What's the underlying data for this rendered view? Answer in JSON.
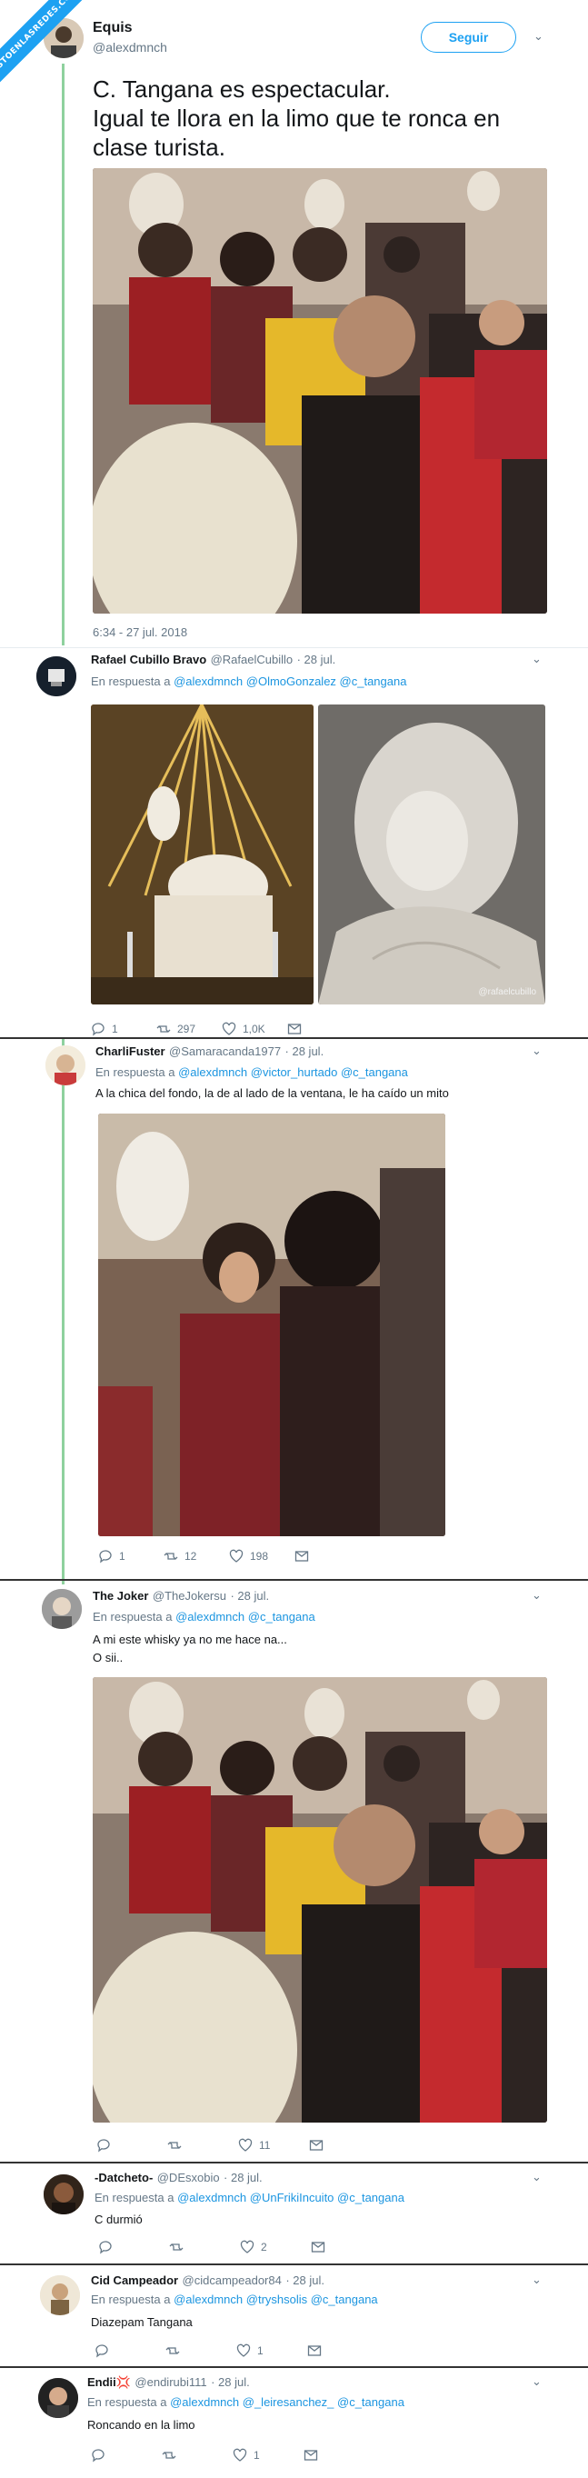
{
  "watermark": "VISTOENLASREDES.COM",
  "main_tweet": {
    "name": "Equis",
    "handle": "@alexdmnch",
    "follow_label": "Seguir",
    "text_line1": "C. Tangana es espectacular.",
    "text_line2": "Igual te llora en la limo que te ronca en",
    "text_line3": "clase turista.",
    "timestamp": "6:34 - 27 jul. 2018"
  },
  "replies": [
    {
      "name": "Rafael Cubillo Bravo",
      "handle": "@RafaelCubillo",
      "date": "· 28 jul.",
      "reply_prefix": "En respuesta a",
      "mentions": "@alexdmnch @OlmoGonzalez @c_tangana",
      "text": "",
      "photo_credit": "@rafaelcubillo",
      "replies_count": "1",
      "retweets_count": "297",
      "likes_count": "1,0K"
    },
    {
      "name": "CharliFuster",
      "handle": "@Samaracanda1977",
      "date": "· 28 jul.",
      "reply_prefix": "En respuesta a",
      "mentions": "@alexdmnch @victor_hurtado @c_tangana",
      "text": "A la chica del fondo, la de al lado de la ventana, le ha caído un mito",
      "replies_count": "1",
      "retweets_count": "12",
      "likes_count": "198"
    },
    {
      "name": "The Joker",
      "handle": "@TheJokersu",
      "date": "· 28 jul.",
      "reply_prefix": "En respuesta a",
      "mentions": "@alexdmnch @c_tangana",
      "text_line1": "A mi este whisky ya no me hace na...",
      "text_line2": "O sii..",
      "replies_count": "",
      "retweets_count": "",
      "likes_count": "11"
    },
    {
      "name": "-Datcheto-",
      "handle": "@DEsxobio",
      "date": "· 28 jul.",
      "reply_prefix": "En respuesta a",
      "mentions": "@alexdmnch @UnFrikiIncuito @c_tangana",
      "text": "C durmió",
      "replies_count": "",
      "retweets_count": "",
      "likes_count": "2"
    },
    {
      "name": "Cid Campeador",
      "handle": "@cidcampeador84",
      "date": "· 28 jul.",
      "reply_prefix": "En respuesta a",
      "mentions": "@alexdmnch @tryshsolis @c_tangana",
      "text": "Diazepam Tangana",
      "replies_count": "",
      "retweets_count": "",
      "likes_count": "1"
    },
    {
      "name": "Endii💢",
      "handle": "@endirubi111",
      "date": "· 28 jul.",
      "reply_prefix": "En respuesta a",
      "mentions": "@alexdmnch @_leiresanchez_ @c_tangana",
      "text": "Roncando en la limo",
      "replies_count": "",
      "retweets_count": "",
      "likes_count": "1"
    }
  ],
  "colors": {
    "accent": "#1da1f2",
    "thread_line": "#8fd19e",
    "text_secondary": "#657786",
    "mention": "#1b95e0"
  }
}
